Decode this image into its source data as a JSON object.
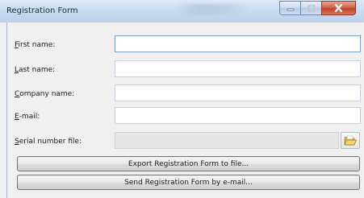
{
  "window": {
    "title": "Registration Form",
    "controls": {
      "minimize": "minimize-icon",
      "maximize": "maximize-icon",
      "close": "close-icon"
    }
  },
  "form": {
    "first_name": {
      "label_mnemonic": "F",
      "label_rest": "irst name:",
      "value": ""
    },
    "last_name": {
      "label_mnemonic": "L",
      "label_rest": "ast name:",
      "value": ""
    },
    "company_name": {
      "label_mnemonic": "C",
      "label_rest": "ompany name:",
      "value": ""
    },
    "email": {
      "label_mnemonic": "E",
      "label_rest": "-mail:",
      "value": ""
    },
    "serial_file": {
      "label_mnemonic": "S",
      "label_rest": "erial number file:",
      "value": "",
      "browse_icon": "open-folder-icon"
    }
  },
  "actions": {
    "export_label": "Export Registration Form to file...",
    "send_label": "Send Registration Form by e-mail..."
  },
  "colors": {
    "titlebar": "#c9dcf1",
    "close_button": "#c24328",
    "window_bg": "#f0f0f0",
    "focus_border": "#7da2ce"
  }
}
